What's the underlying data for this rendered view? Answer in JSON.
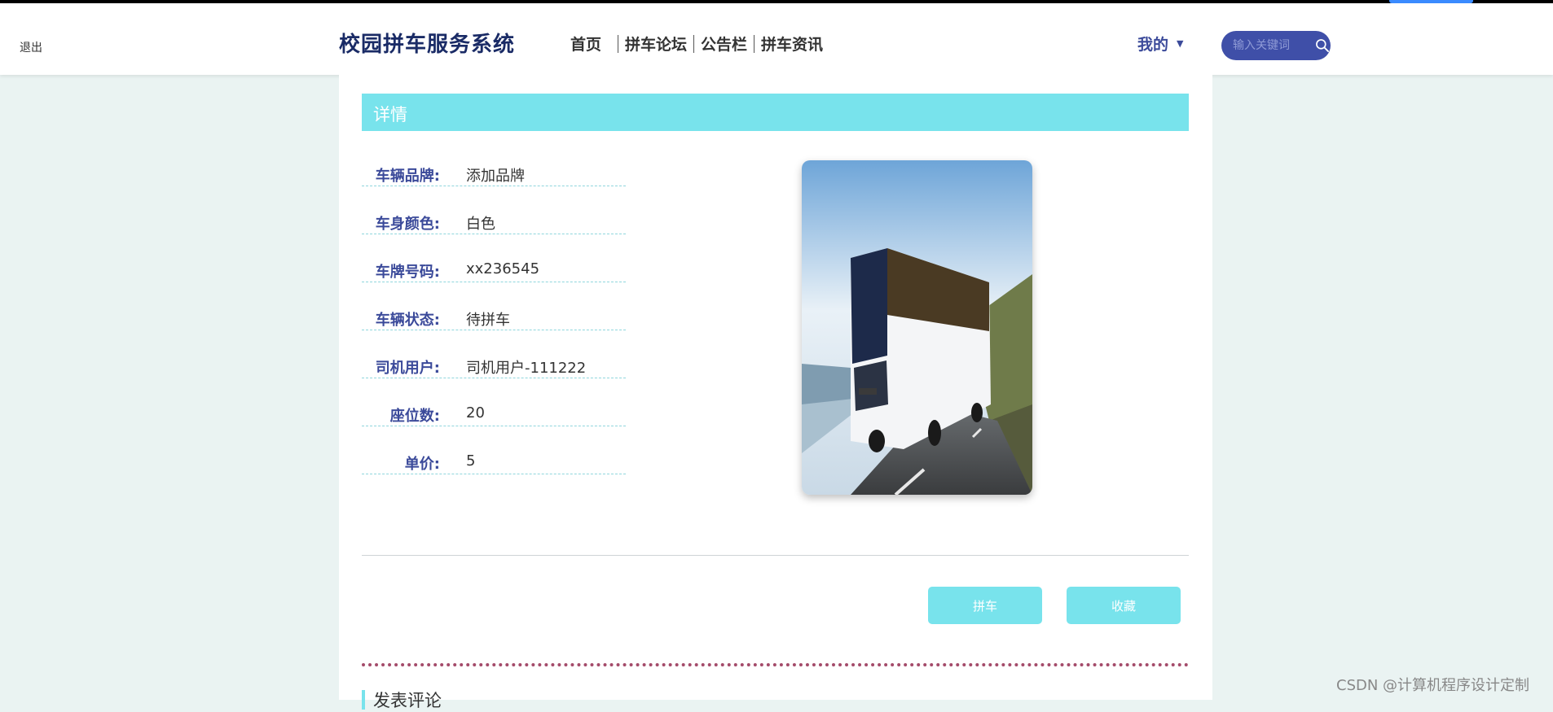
{
  "header": {
    "exit_text": "退出",
    "site_title": "校园拼车服务系统",
    "nav": [
      "首页",
      "拼车论坛",
      "公告栏",
      "拼车资讯"
    ],
    "mine_label": "我的",
    "search_placeholder": "输入关键词"
  },
  "detail": {
    "section_title": "详情",
    "fields": [
      {
        "label": "车辆品牌:",
        "value": "添加品牌"
      },
      {
        "label": "车身颜色:",
        "value": "白色"
      },
      {
        "label": "车牌号码:",
        "value": "xx236545"
      },
      {
        "label": "车辆状态:",
        "value": "待拼车"
      },
      {
        "label": "司机用户:",
        "value": "司机用户-111222"
      },
      {
        "label": "座位数:",
        "value": "20"
      },
      {
        "label": "单价:",
        "value": "5"
      }
    ],
    "actions": {
      "carpool": "拼车",
      "favorite": "收藏"
    }
  },
  "comment_section": {
    "title": "发表评论"
  },
  "watermark": "CSDN @计算机程序设计定制",
  "colors": {
    "accent": "#78e3ec",
    "nav_blue": "#3f4fa8",
    "title_blue": "#1a2b66"
  }
}
